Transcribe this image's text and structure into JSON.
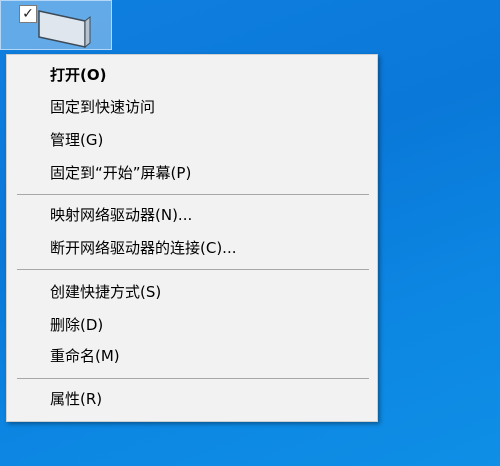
{
  "desktop": {
    "selected_item_checkbox": "✓",
    "background_color": "#0a78d8"
  },
  "context_menu": {
    "groups": [
      [
        "打开(O)",
        "固定到快速访问",
        "管理(G)",
        "固定到“开始”屏幕(P)"
      ],
      [
        "映射网络驱动器(N)...",
        "断开网络驱动器的连接(C)..."
      ],
      [
        "创建快捷方式(S)",
        "删除(D)",
        "重命名(M)"
      ],
      [
        "属性(R)"
      ]
    ],
    "default_item": "打开(O)"
  }
}
